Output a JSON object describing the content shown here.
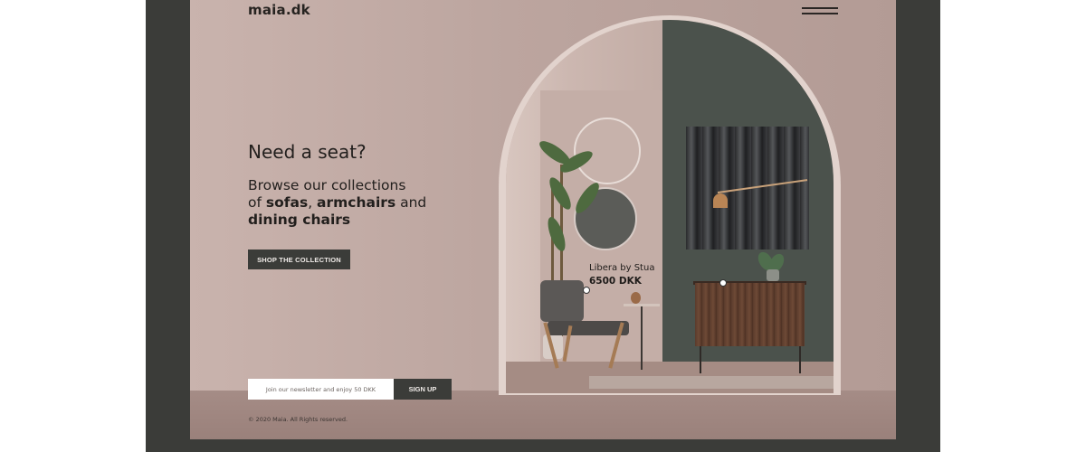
{
  "header": {
    "logo": "maia.dk",
    "menu_icon": "hamburger-menu-icon"
  },
  "hero": {
    "headline": "Need a seat?",
    "sub_line1": "Browse our collections",
    "sub_of": "of ",
    "sub_sofas": "sofas",
    "sub_comma": ", ",
    "sub_armchairs": "armchairs",
    "sub_and": " and",
    "sub_dining": "dining chairs",
    "cta_label": "SHOP THE COLLECTION"
  },
  "product_callout": {
    "name": "Libera by Stua",
    "price": "6500 DKK"
  },
  "newsletter": {
    "placeholder": "Join our newsletter and enjoy 50 DKK",
    "button_label": "SIGN UP"
  },
  "footer": {
    "copyright": "© 2020 Maia. All Rights reserved."
  },
  "colors": {
    "frame": "#3b3c39",
    "page_bg": "#c9b3ad",
    "button_bg": "#3b3c39",
    "text": "#221f1d"
  }
}
